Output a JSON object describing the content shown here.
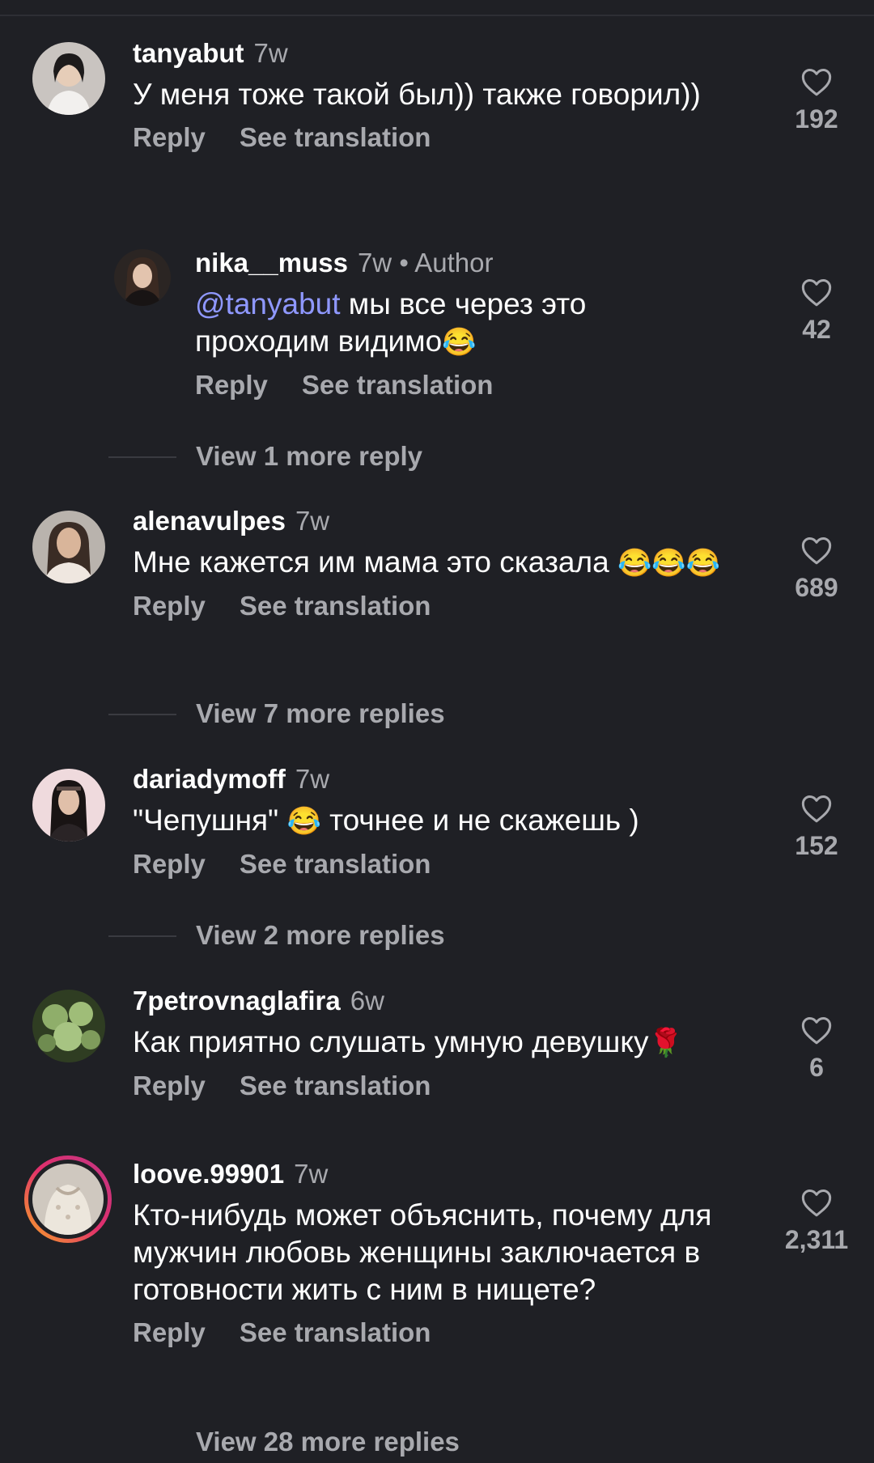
{
  "colors": {
    "background": "#1f2025",
    "secondary_text": "#a8a9ae",
    "mention": "#8f98ff",
    "story_ring_start": "#f9a825",
    "story_ring_end": "#c13584"
  },
  "icons": {
    "like": "heart-outline-icon"
  },
  "comments": [
    {
      "username": "tanyabut",
      "time": "7w",
      "text": "У меня тоже такой был)) также говорил))",
      "reply_label": "Reply",
      "translate_label": "See translation",
      "likes": "192",
      "replies": [
        {
          "username": "nika__muss",
          "time": "7w",
          "author_tag": "• Author",
          "mention": "@tanyabut",
          "text": " мы все через это проходим видимо",
          "emoji": "😂",
          "reply_label": "Reply",
          "translate_label": "See translation",
          "likes": "42"
        }
      ],
      "view_more": "View 1 more reply"
    },
    {
      "username": "alenavulpes",
      "time": "7w",
      "text": "Мне кажется им мама это сказала",
      "emoji": "😂😂😂",
      "reply_label": "Reply",
      "translate_label": "See translation",
      "likes": "689",
      "view_more": "View 7 more replies"
    },
    {
      "username": "dariadymoff",
      "time": "7w",
      "text_before": "\"Чепушня\" ",
      "emoji": "😂",
      "text_after": " точнее и не скажешь )",
      "reply_label": "Reply",
      "translate_label": "See translation",
      "likes": "152",
      "view_more": "View 2 more replies"
    },
    {
      "username": "7petrovnaglafira",
      "time": "6w",
      "text": "Как приятно слушать умную девушку",
      "emoji": "🌹",
      "reply_label": "Reply",
      "translate_label": "See translation",
      "likes": "6"
    },
    {
      "username": "loove.99901",
      "time": "7w",
      "text": "Кто-нибудь может объяснить, почему для мужчин любовь женщины заключается в готовности жить с ним в нищете?",
      "reply_label": "Reply",
      "translate_label": "See translation",
      "likes": "2,311",
      "view_more": "View 28 more replies"
    }
  ]
}
